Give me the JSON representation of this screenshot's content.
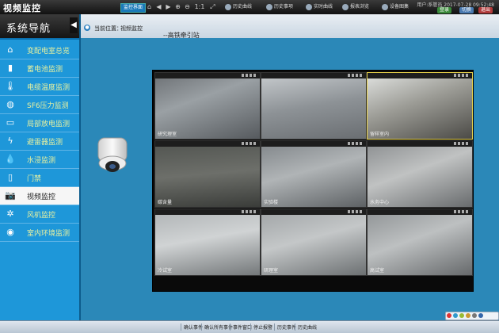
{
  "app_title": "视频监控",
  "toolbar": {
    "nav_label": "监控界面",
    "buttons": [
      "历史曲线",
      "历史事项",
      "实时曲线",
      "报表浏览",
      "设备图集"
    ],
    "datetime": "用户:系管员 2017-07-28 09:52:48",
    "login_label": "登录",
    "switch_label": "切换",
    "exit_label": "退出"
  },
  "sidebar": {
    "title": "系统导航",
    "toggle": "◀",
    "items": [
      {
        "label": "变配电室总览",
        "icon": "home-icon",
        "glyph": "⌂"
      },
      {
        "label": "蓄电池监测",
        "icon": "battery-icon",
        "glyph": "▮"
      },
      {
        "label": "电缆温度监测",
        "icon": "thermometer-icon",
        "glyph": "🌡"
      },
      {
        "label": "SF6压力监测",
        "icon": "gauge-icon",
        "glyph": "◍"
      },
      {
        "label": "局部放电监测",
        "icon": "discharge-icon",
        "glyph": "▭"
      },
      {
        "label": "避雷器监测",
        "icon": "lightning-icon",
        "glyph": "ϟ"
      },
      {
        "label": "水浸监测",
        "icon": "water-drop-icon",
        "glyph": "💧"
      },
      {
        "label": "门禁",
        "icon": "door-icon",
        "glyph": "▯"
      },
      {
        "label": "视频监控",
        "icon": "camera-icon",
        "glyph": "📷"
      },
      {
        "label": "风机监控",
        "icon": "fan-icon",
        "glyph": "✲"
      },
      {
        "label": "室内环境监测",
        "icon": "environment-icon",
        "glyph": "◉"
      }
    ]
  },
  "breadcrumb": {
    "label": "当前位置：",
    "value": "视频监控"
  },
  "subtitle": "--高铁牵引站",
  "cameras": [
    {
      "caption": "研究理室"
    },
    {
      "caption": ""
    },
    {
      "caption": "留样室内"
    },
    {
      "caption": "碳含量"
    },
    {
      "caption": "实验楼"
    },
    {
      "caption": "水务中心"
    },
    {
      "caption": "冷试室"
    },
    {
      "caption": "研理室"
    },
    {
      "caption": "高试室"
    }
  ],
  "statusbar": {
    "buttons": [
      "确认事件",
      "确认所有事件",
      "事件窗口",
      "停止报警",
      "历史事件",
      "历史曲线"
    ]
  },
  "colors": {
    "sidebar": "#1e97d9",
    "active_item": "#f6f6f6",
    "label_text": "#e8f1a0",
    "main": "#2b88b8"
  }
}
